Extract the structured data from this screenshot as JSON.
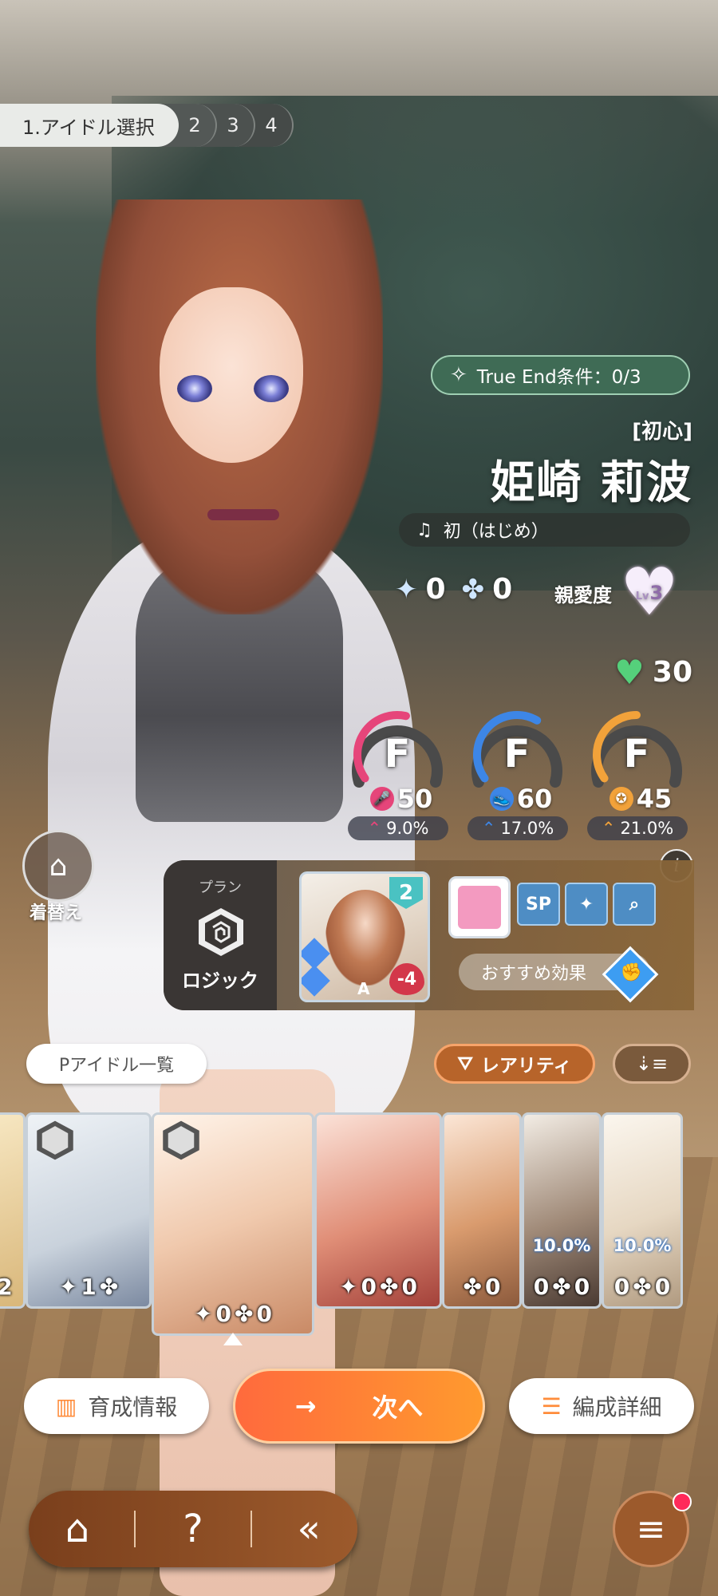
{
  "steps": {
    "active": "1.アイドル選択",
    "others": [
      "2",
      "3",
      "4"
    ]
  },
  "true_end": {
    "label": "True End条件：0/3"
  },
  "idol": {
    "rarity": "[初心]",
    "name": "姫崎 莉波",
    "song": "初（はじめ）"
  },
  "resources": {
    "sparkle": "0",
    "clover": "0"
  },
  "affection": {
    "label": "親愛度",
    "level_prefix": "Lv",
    "level": "3"
  },
  "stamina": {
    "value": "30"
  },
  "params": [
    {
      "name": "vocal",
      "grade": "F",
      "value": "50",
      "growth": "9.0%",
      "color": "#e6457a",
      "fill": 0.55
    },
    {
      "name": "dance",
      "grade": "F",
      "value": "60",
      "growth": "17.0%",
      "color": "#3d86e6",
      "fill": 0.62
    },
    {
      "name": "visual",
      "grade": "F",
      "value": "45",
      "growth": "21.0%",
      "color": "#f2a23a",
      "fill": 0.5
    }
  ],
  "plan": {
    "header": "プラン",
    "name": "ロジック",
    "card_level": "2",
    "card_cost": "-4",
    "card_letter": "A",
    "sp_label": "SP",
    "recommend": "おすすめ効果"
  },
  "dress": {
    "label": "着替え"
  },
  "list": {
    "button": "Pアイドル一覧",
    "rarity_filter": "レアリティ"
  },
  "idol_cards": [
    {
      "id": "partial-left",
      "stat": "2"
    },
    {
      "id": "silver-hair",
      "stat_a": "1",
      "stat_b": ""
    },
    {
      "id": "rinami",
      "stat_a": "0",
      "stat_b": "0",
      "selected": true
    },
    {
      "id": "red-hair",
      "stat_a": "0",
      "stat_b": "0"
    },
    {
      "id": "brown-short",
      "stat_a": "",
      "stat_b": "0"
    },
    {
      "id": "dark-hair",
      "bonus": "10.0%",
      "stat_a": "0",
      "stat_b": "0"
    },
    {
      "id": "blonde",
      "bonus": "10.0%",
      "stat_a": "0",
      "stat_b": "0"
    }
  ],
  "actions": {
    "info": "育成情報",
    "next": "次へ",
    "edit": "編成詳細"
  },
  "colors": {
    "accent_orange": "#ff8c3a",
    "nav_brown": "#9c5a2c",
    "true_end_green": "#3f6b55"
  }
}
